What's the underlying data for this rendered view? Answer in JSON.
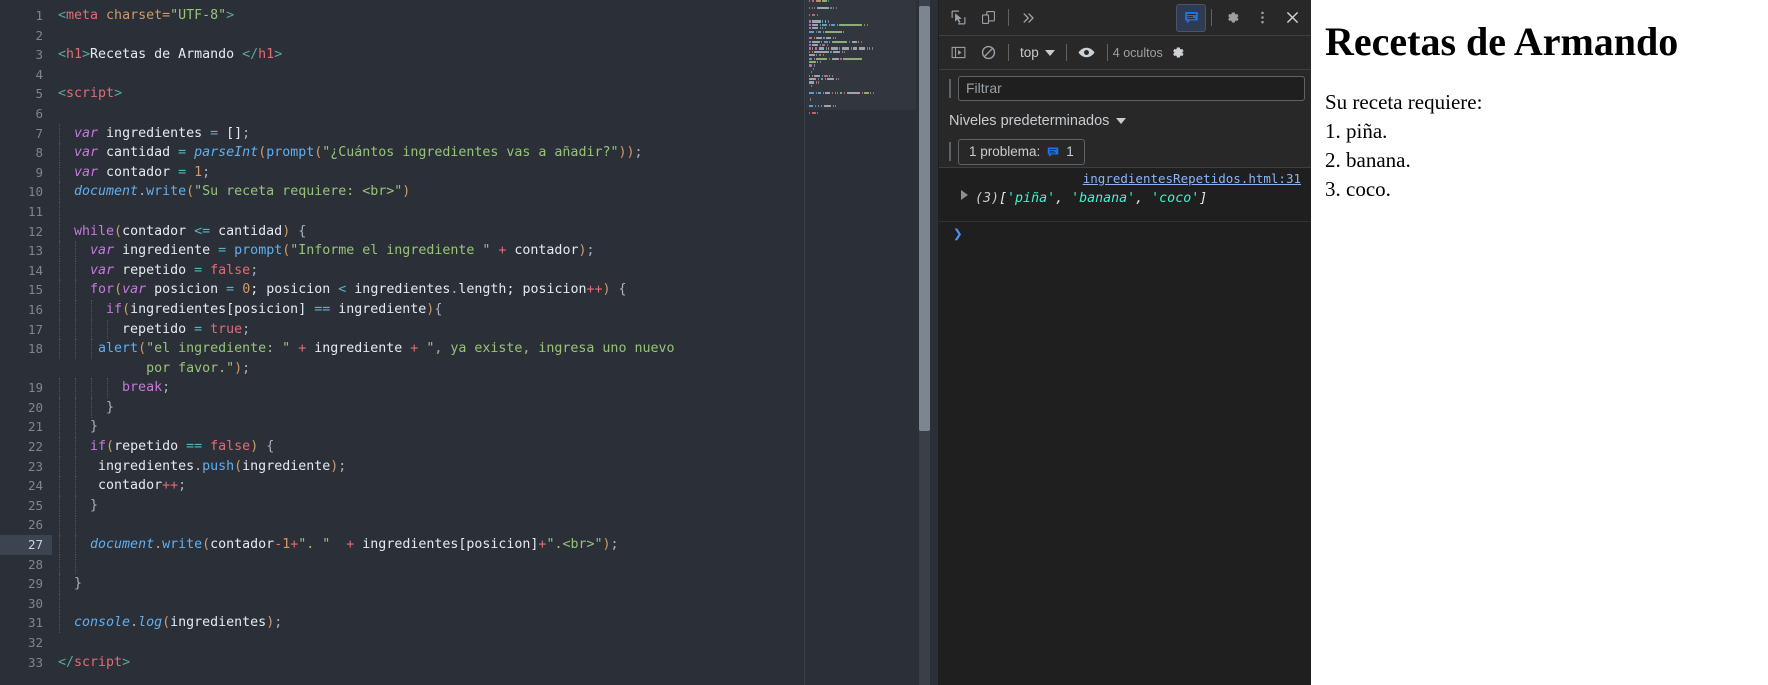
{
  "editor": {
    "active_line": 27,
    "lines": [
      {
        "n": 1,
        "tokens": [
          {
            "t": "<",
            "c": "t-brk"
          },
          {
            "t": "meta",
            "c": "t-tag"
          },
          {
            "t": " charset=",
            "c": "t-attr"
          },
          {
            "t": "\"UTF-8\"",
            "c": "t-str"
          },
          {
            "t": ">",
            "c": "t-brk"
          }
        ],
        "indent": 0
      },
      {
        "n": 2,
        "tokens": [],
        "indent": 0
      },
      {
        "n": 3,
        "tokens": [
          {
            "t": "<",
            "c": "t-brk"
          },
          {
            "t": "h1",
            "c": "t-tag"
          },
          {
            "t": ">",
            "c": "t-brk"
          },
          {
            "t": "Recetas de Armando ",
            "c": "t-id"
          },
          {
            "t": "</",
            "c": "t-brk"
          },
          {
            "t": "h1",
            "c": "t-tag"
          },
          {
            "t": ">",
            "c": "t-brk"
          }
        ],
        "indent": 0
      },
      {
        "n": 4,
        "tokens": [],
        "indent": 0
      },
      {
        "n": 5,
        "tokens": [
          {
            "t": "<",
            "c": "t-brk"
          },
          {
            "t": "script",
            "c": "t-tag"
          },
          {
            "t": ">",
            "c": "t-brk"
          }
        ],
        "indent": 0
      },
      {
        "n": 6,
        "tokens": [],
        "indent": 0
      },
      {
        "n": 7,
        "tokens": [
          {
            "t": "  ",
            "c": "t-id"
          },
          {
            "t": "var",
            "c": "t-var"
          },
          {
            "t": " ingredientes ",
            "c": "t-id"
          },
          {
            "t": "=",
            "c": "t-op"
          },
          {
            "t": " []",
            "c": "t-id"
          },
          {
            "t": ";",
            "c": "t-punc"
          }
        ],
        "indent": 1
      },
      {
        "n": 8,
        "tokens": [
          {
            "t": "  ",
            "c": "t-id"
          },
          {
            "t": "var",
            "c": "t-var"
          },
          {
            "t": " cantidad ",
            "c": "t-id"
          },
          {
            "t": "=",
            "c": "t-op"
          },
          {
            "t": " ",
            "c": "t-id"
          },
          {
            "t": "parseInt",
            "c": "t-fn"
          },
          {
            "t": "(",
            "c": "t-paren"
          },
          {
            "t": "prompt",
            "c": "t-fn2"
          },
          {
            "t": "(",
            "c": "t-paren"
          },
          {
            "t": "\"¿Cuántos ingredientes vas a añadir?\"",
            "c": "t-str"
          },
          {
            "t": "))",
            "c": "t-paren"
          },
          {
            "t": ";",
            "c": "t-punc"
          }
        ],
        "indent": 1
      },
      {
        "n": 9,
        "tokens": [
          {
            "t": "  ",
            "c": "t-id"
          },
          {
            "t": "var",
            "c": "t-var"
          },
          {
            "t": " contador ",
            "c": "t-id"
          },
          {
            "t": "=",
            "c": "t-op"
          },
          {
            "t": " ",
            "c": "t-id"
          },
          {
            "t": "1",
            "c": "t-num"
          },
          {
            "t": ";",
            "c": "t-punc"
          }
        ],
        "indent": 1
      },
      {
        "n": 10,
        "tokens": [
          {
            "t": "  ",
            "c": "t-id"
          },
          {
            "t": "document",
            "c": "t-fn"
          },
          {
            "t": ".",
            "c": "t-punc"
          },
          {
            "t": "write",
            "c": "t-fn2"
          },
          {
            "t": "(",
            "c": "t-paren"
          },
          {
            "t": "\"Su receta requiere: <br>\"",
            "c": "t-str"
          },
          {
            "t": ")",
            "c": "t-paren"
          }
        ],
        "indent": 1
      },
      {
        "n": 11,
        "tokens": [],
        "indent": 1
      },
      {
        "n": 12,
        "tokens": [
          {
            "t": "  ",
            "c": "t-id"
          },
          {
            "t": "while",
            "c": "t-kw"
          },
          {
            "t": "(",
            "c": "t-paren"
          },
          {
            "t": "contador ",
            "c": "t-id"
          },
          {
            "t": "<=",
            "c": "t-op"
          },
          {
            "t": " cantidad",
            "c": "t-id"
          },
          {
            "t": ")",
            "c": "t-paren"
          },
          {
            "t": " {",
            "c": "t-punc"
          }
        ],
        "indent": 1
      },
      {
        "n": 13,
        "tokens": [
          {
            "t": "    ",
            "c": "t-id"
          },
          {
            "t": "var",
            "c": "t-var"
          },
          {
            "t": " ingrediente ",
            "c": "t-id"
          },
          {
            "t": "=",
            "c": "t-op"
          },
          {
            "t": " ",
            "c": "t-id"
          },
          {
            "t": "prompt",
            "c": "t-fn2"
          },
          {
            "t": "(",
            "c": "t-paren"
          },
          {
            "t": "\"Informe el ingrediente \"",
            "c": "t-str"
          },
          {
            "t": " + ",
            "c": "t-plus"
          },
          {
            "t": "contador",
            "c": "t-id"
          },
          {
            "t": ")",
            "c": "t-paren"
          },
          {
            "t": ";",
            "c": "t-punc"
          }
        ],
        "indent": 2
      },
      {
        "n": 14,
        "tokens": [
          {
            "t": "    ",
            "c": "t-id"
          },
          {
            "t": "var",
            "c": "t-var"
          },
          {
            "t": " repetido ",
            "c": "t-id"
          },
          {
            "t": "=",
            "c": "t-op"
          },
          {
            "t": " ",
            "c": "t-id"
          },
          {
            "t": "false",
            "c": "t-kw2"
          },
          {
            "t": ";",
            "c": "t-punc"
          }
        ],
        "indent": 2
      },
      {
        "n": 15,
        "tokens": [
          {
            "t": "    ",
            "c": "t-id"
          },
          {
            "t": "for",
            "c": "t-kw"
          },
          {
            "t": "(",
            "c": "t-paren"
          },
          {
            "t": "var",
            "c": "t-var"
          },
          {
            "t": " posicion ",
            "c": "t-id"
          },
          {
            "t": "=",
            "c": "t-op"
          },
          {
            "t": " ",
            "c": "t-id"
          },
          {
            "t": "0",
            "c": "t-num"
          },
          {
            "t": "; posicion ",
            "c": "t-id"
          },
          {
            "t": "<",
            "c": "t-op"
          },
          {
            "t": " ingredientes",
            "c": "t-id"
          },
          {
            "t": ".",
            "c": "t-punc"
          },
          {
            "t": "length",
            "c": "t-id"
          },
          {
            "t": "; posicion",
            "c": "t-id"
          },
          {
            "t": "++",
            "c": "t-plus"
          },
          {
            "t": ")",
            "c": "t-paren"
          },
          {
            "t": " {",
            "c": "t-punc"
          }
        ],
        "indent": 2
      },
      {
        "n": 16,
        "tokens": [
          {
            "t": "      ",
            "c": "t-id"
          },
          {
            "t": "if",
            "c": "t-kw"
          },
          {
            "t": "(",
            "c": "t-paren"
          },
          {
            "t": "ingredientes[posicion] ",
            "c": "t-id"
          },
          {
            "t": "==",
            "c": "t-op"
          },
          {
            "t": " ingrediente",
            "c": "t-id"
          },
          {
            "t": ")",
            "c": "t-paren"
          },
          {
            "t": "{",
            "c": "t-punc"
          }
        ],
        "indent": 3
      },
      {
        "n": 17,
        "tokens": [
          {
            "t": "        ",
            "c": "t-id"
          },
          {
            "t": "repetido ",
            "c": "t-id"
          },
          {
            "t": "=",
            "c": "t-op"
          },
          {
            "t": " ",
            "c": "t-id"
          },
          {
            "t": "true",
            "c": "t-kw2"
          },
          {
            "t": ";",
            "c": "t-punc"
          }
        ],
        "indent": 4
      },
      {
        "n": 18,
        "tokens": [
          {
            "t": "     ",
            "c": "t-id"
          },
          {
            "t": "alert",
            "c": "t-fn2"
          },
          {
            "t": "(",
            "c": "t-paren"
          },
          {
            "t": "\"el ingrediente: \"",
            "c": "t-str"
          },
          {
            "t": " + ",
            "c": "t-plus"
          },
          {
            "t": "ingrediente",
            "c": "t-id"
          },
          {
            "t": " + ",
            "c": "t-plus"
          },
          {
            "t": "\", ya existe, ingresa uno nuevo",
            "c": "t-str"
          }
        ],
        "indent": 3
      },
      {
        "n": "",
        "tokens": [
          {
            "t": "           ",
            "c": "t-id"
          },
          {
            "t": "por favor.\"",
            "c": "t-str"
          },
          {
            "t": ")",
            "c": "t-paren"
          },
          {
            "t": ";",
            "c": "t-punc"
          }
        ],
        "indent": 0,
        "wrap": true
      },
      {
        "n": 19,
        "tokens": [
          {
            "t": "        ",
            "c": "t-id"
          },
          {
            "t": "break",
            "c": "t-kw"
          },
          {
            "t": ";",
            "c": "t-punc"
          }
        ],
        "indent": 4
      },
      {
        "n": 20,
        "tokens": [
          {
            "t": "      }",
            "c": "t-punc"
          }
        ],
        "indent": 3
      },
      {
        "n": 21,
        "tokens": [
          {
            "t": "    }",
            "c": "t-punc"
          }
        ],
        "indent": 2
      },
      {
        "n": 22,
        "tokens": [
          {
            "t": "    ",
            "c": "t-id"
          },
          {
            "t": "if",
            "c": "t-kw"
          },
          {
            "t": "(",
            "c": "t-paren"
          },
          {
            "t": "repetido ",
            "c": "t-id"
          },
          {
            "t": "==",
            "c": "t-op"
          },
          {
            "t": " ",
            "c": "t-id"
          },
          {
            "t": "false",
            "c": "t-kw2"
          },
          {
            "t": ")",
            "c": "t-paren"
          },
          {
            "t": " {",
            "c": "t-punc"
          }
        ],
        "indent": 2
      },
      {
        "n": 23,
        "tokens": [
          {
            "t": "     ",
            "c": "t-id"
          },
          {
            "t": "ingredientes",
            "c": "t-id"
          },
          {
            "t": ".",
            "c": "t-punc"
          },
          {
            "t": "push",
            "c": "t-fn2"
          },
          {
            "t": "(",
            "c": "t-paren"
          },
          {
            "t": "ingrediente",
            "c": "t-id"
          },
          {
            "t": ")",
            "c": "t-paren"
          },
          {
            "t": ";",
            "c": "t-punc"
          }
        ],
        "indent": 2
      },
      {
        "n": 24,
        "tokens": [
          {
            "t": "     ",
            "c": "t-id"
          },
          {
            "t": "contador",
            "c": "t-id"
          },
          {
            "t": "++",
            "c": "t-plus"
          },
          {
            "t": ";",
            "c": "t-punc"
          }
        ],
        "indent": 2
      },
      {
        "n": 25,
        "tokens": [
          {
            "t": "    }",
            "c": "t-punc"
          }
        ],
        "indent": 2
      },
      {
        "n": 26,
        "tokens": [],
        "indent": 2
      },
      {
        "n": 27,
        "tokens": [
          {
            "t": "    ",
            "c": "t-id"
          },
          {
            "t": "document",
            "c": "t-fn"
          },
          {
            "t": ".",
            "c": "t-punc"
          },
          {
            "t": "write",
            "c": "t-fn2"
          },
          {
            "t": "(",
            "c": "t-paren"
          },
          {
            "t": "contador",
            "c": "t-id"
          },
          {
            "t": "-",
            "c": "t-plus"
          },
          {
            "t": "1",
            "c": "t-num"
          },
          {
            "t": "+",
            "c": "t-plus"
          },
          {
            "t": "\". \"",
            "c": "t-str"
          },
          {
            "t": "  + ",
            "c": "t-plus"
          },
          {
            "t": "ingredientes[posicion]",
            "c": "t-id"
          },
          {
            "t": "+",
            "c": "t-plus"
          },
          {
            "t": "\".<br>\"",
            "c": "t-str"
          },
          {
            "t": ")",
            "c": "t-paren"
          },
          {
            "t": ";",
            "c": "t-punc"
          }
        ],
        "indent": 2,
        "active": true
      },
      {
        "n": 28,
        "tokens": [],
        "indent": 2
      },
      {
        "n": 29,
        "tokens": [
          {
            "t": "  }",
            "c": "t-punc"
          }
        ],
        "indent": 1
      },
      {
        "n": 30,
        "tokens": [],
        "indent": 1
      },
      {
        "n": 31,
        "tokens": [
          {
            "t": "  ",
            "c": "t-id"
          },
          {
            "t": "console",
            "c": "t-fn"
          },
          {
            "t": ".",
            "c": "t-punc"
          },
          {
            "t": "log",
            "c": "t-fn"
          },
          {
            "t": "(",
            "c": "t-paren"
          },
          {
            "t": "ingredientes",
            "c": "t-id"
          },
          {
            "t": ")",
            "c": "t-paren"
          },
          {
            "t": ";",
            "c": "t-punc"
          }
        ],
        "indent": 1
      },
      {
        "n": 32,
        "tokens": [],
        "indent": 0
      },
      {
        "n": 33,
        "tokens": [
          {
            "t": "</",
            "c": "t-brk"
          },
          {
            "t": "script",
            "c": "t-tag"
          },
          {
            "t": ">",
            "c": "t-brk"
          }
        ],
        "indent": 0
      }
    ]
  },
  "devtools": {
    "toolbar": {
      "inspect_icon": "inspect-cursor-icon",
      "device_toolbar_icon": "device-toolbar-icon",
      "more_panels_icon": "chevron-double-right-icon",
      "console_panel_icon": "console-message-icon",
      "settings_icon": "gear-icon",
      "more_options_icon": "kebab-menu-icon",
      "close_icon": "close-icon"
    },
    "console_toolbar": {
      "sidebar_icon": "console-sidebar-icon",
      "clear_icon": "clear-console-icon",
      "context_label": "top",
      "eye_icon": "live-expression-eye-icon",
      "hidden_label": "4 ocultos",
      "settings_icon": "gear-icon"
    },
    "filter": {
      "placeholder": "Filtrar",
      "value": ""
    },
    "levels": {
      "label": "Niveles predeterminados"
    },
    "problems": {
      "label": "1 problema:",
      "count": "1",
      "icon": "console-message-icon"
    },
    "log": {
      "source": "ingredientesRepetidos.html:31",
      "count": "(3)",
      "open_bracket": "[",
      "items": [
        "'piña'",
        "'banana'",
        "'coco'"
      ],
      "close_bracket": "]",
      "separator": ", ",
      "expand_icon": "triangle-right-icon"
    },
    "prompt": {
      "chevron": "❯"
    }
  },
  "page": {
    "title": "Recetas de Armando",
    "intro": "Su receta requiere:",
    "items": [
      "1. piña.",
      "2. banana.",
      "3. coco."
    ]
  },
  "colors": {
    "editor_bg": "#2b3038",
    "devtools_bg": "#282828",
    "console_bg": "#1f1f1f",
    "accent_blue": "#4f8fff",
    "link_blue": "#8ab4f8",
    "string_green": "#98c379",
    "array_string": "#3df5cf",
    "page_bg": "#ffffff"
  }
}
